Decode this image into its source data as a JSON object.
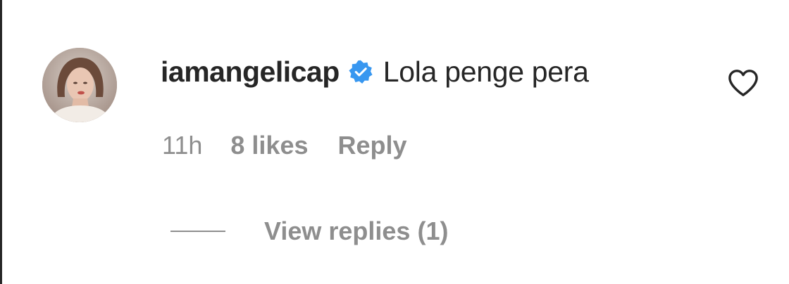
{
  "comment": {
    "username": "iamangelicap",
    "verified": true,
    "text": "Lola penge pera",
    "time": "11h",
    "likes": "8 likes",
    "reply_label": "Reply",
    "view_replies_label": "View replies (1)"
  },
  "icons": {
    "verified": "verified-badge-icon",
    "like": "heart-outline-icon"
  },
  "colors": {
    "text_primary": "#262626",
    "text_secondary": "#8e8e8e",
    "verified_blue": "#3897f0",
    "background": "#ffffff"
  }
}
